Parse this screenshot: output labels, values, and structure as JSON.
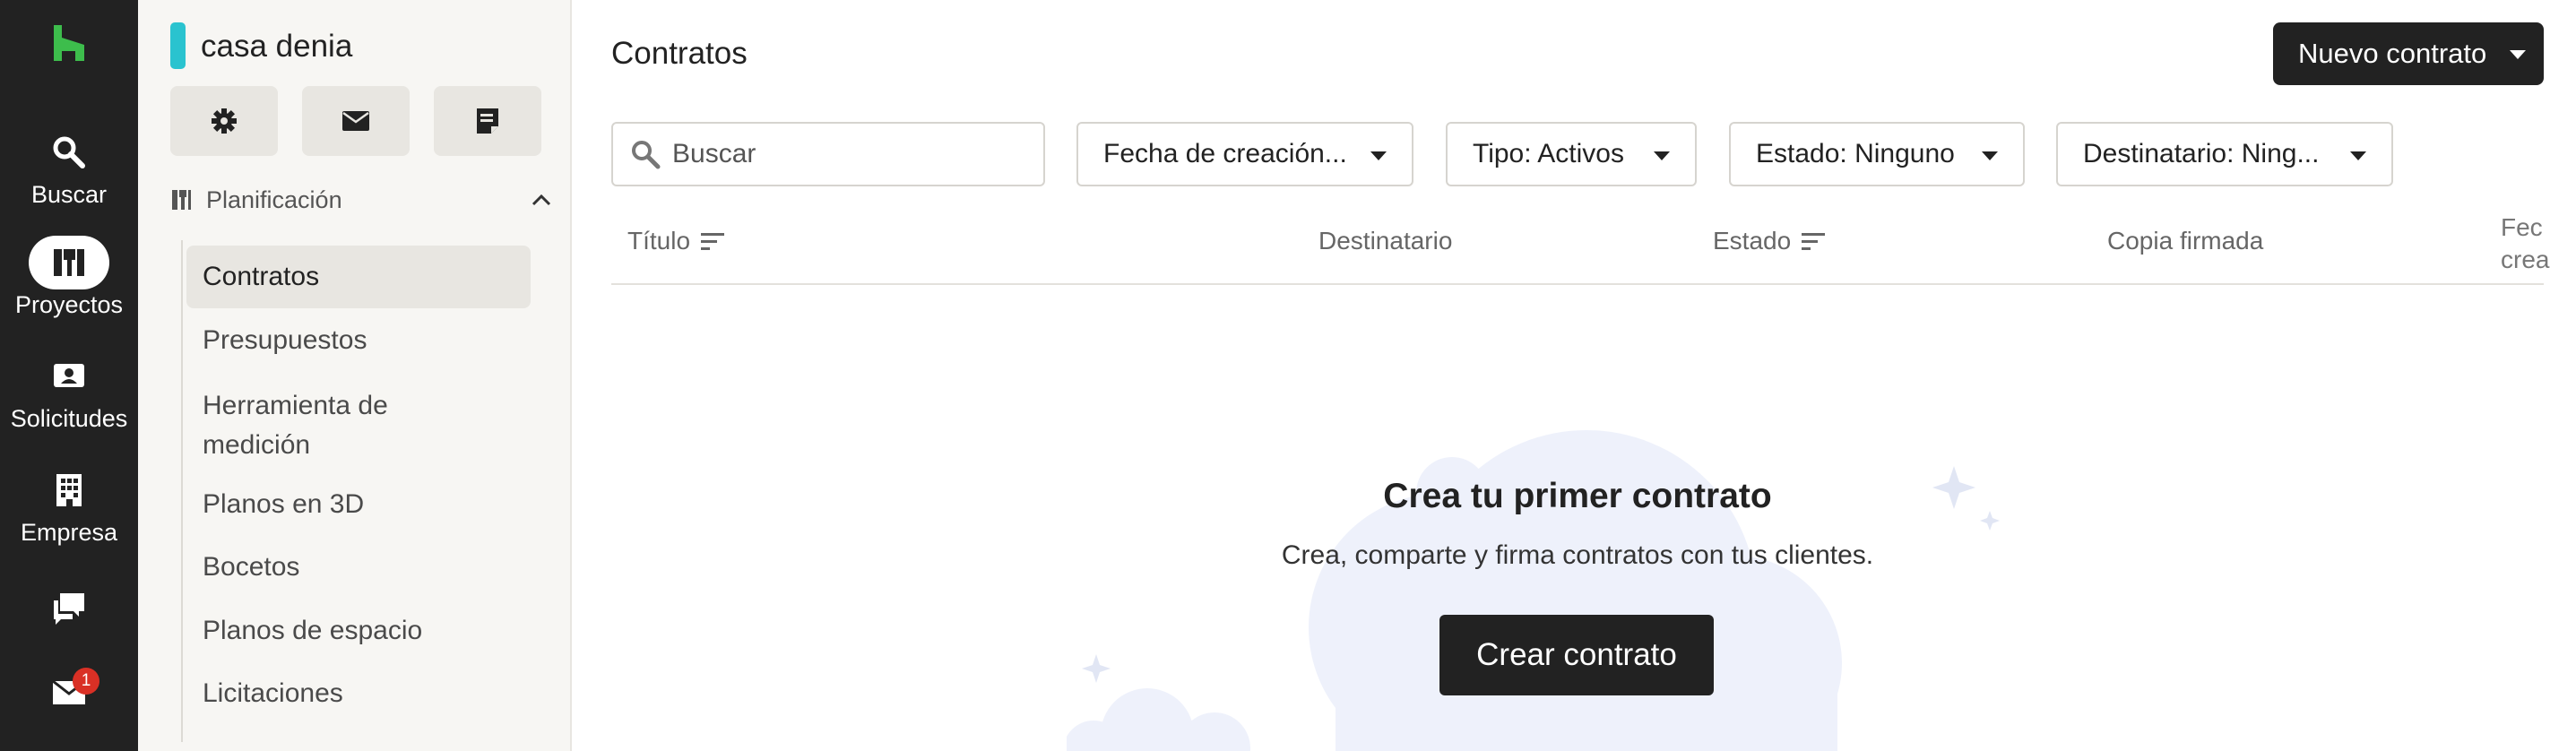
{
  "rail": {
    "items": [
      {
        "label": "Buscar",
        "icon": "search-icon"
      },
      {
        "label": "Proyectos",
        "icon": "projects-icon"
      },
      {
        "label": "Solicitudes",
        "icon": "requests-icon"
      },
      {
        "label": "Empresa",
        "icon": "building-icon"
      },
      {
        "label": "",
        "icon": "chat-icon"
      },
      {
        "label": "",
        "icon": "inbox-icon"
      }
    ],
    "inbox_badge": "1"
  },
  "sidebar": {
    "project_name": "casa denia",
    "project_color": "#2ac3cf",
    "section_label": "Planificación",
    "items": [
      {
        "label": "Contratos"
      },
      {
        "label": "Presupuestos"
      },
      {
        "label": "Herramienta de medición"
      },
      {
        "label": "Planos en 3D"
      },
      {
        "label": "Bocetos"
      },
      {
        "label": "Planos de espacio"
      },
      {
        "label": "Licitaciones"
      }
    ]
  },
  "main": {
    "title": "Contratos",
    "new_button": "Nuevo contrato",
    "search_placeholder": "Buscar",
    "filters": [
      {
        "label": "Fecha de creación..."
      },
      {
        "label": "Tipo: Activos"
      },
      {
        "label": "Estado: Ninguno"
      },
      {
        "label": "Destinatario: Ning..."
      }
    ],
    "columns": [
      {
        "label": "Título"
      },
      {
        "label": "Destinatario"
      },
      {
        "label": "Estado"
      },
      {
        "label": "Copia firmada"
      },
      {
        "label": "Fec\ncrea"
      }
    ],
    "empty": {
      "title": "Crea tu primer contrato",
      "subtitle": "Crea, comparte y firma contratos con tus clientes.",
      "button": "Crear contrato"
    }
  },
  "colors": {
    "rail_bg": "#222222",
    "brand_green": "#3dbd4c",
    "sidebar_bg": "#f7f6f3",
    "badge_red": "#d93025"
  }
}
